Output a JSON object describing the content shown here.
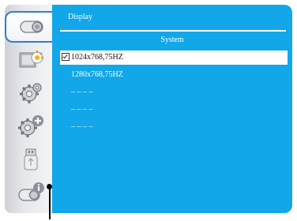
{
  "menu": {
    "title": "Display",
    "section": "System",
    "rows": [
      {
        "label": "1024x768,75HZ",
        "checked": true
      },
      {
        "label": "1280x768,75HZ",
        "checked": false
      },
      {
        "label": "–   –   –   –",
        "checked": false
      },
      {
        "label": "–   –   –   –",
        "checked": false
      },
      {
        "label": "–   –   –   –",
        "checked": false
      }
    ]
  },
  "sidebar": {
    "items": [
      {
        "icon": "display-icon",
        "active": true
      },
      {
        "icon": "image-adjust-icon",
        "active": false
      },
      {
        "icon": "setting-gear-icon",
        "active": false
      },
      {
        "icon": "advanced-gear-icon",
        "active": false
      },
      {
        "icon": "usb-icon",
        "active": false
      },
      {
        "icon": "info-icon",
        "active": false
      }
    ]
  },
  "colors": {
    "panel": "#12a7e8",
    "active_border": "#2f7ec7"
  }
}
